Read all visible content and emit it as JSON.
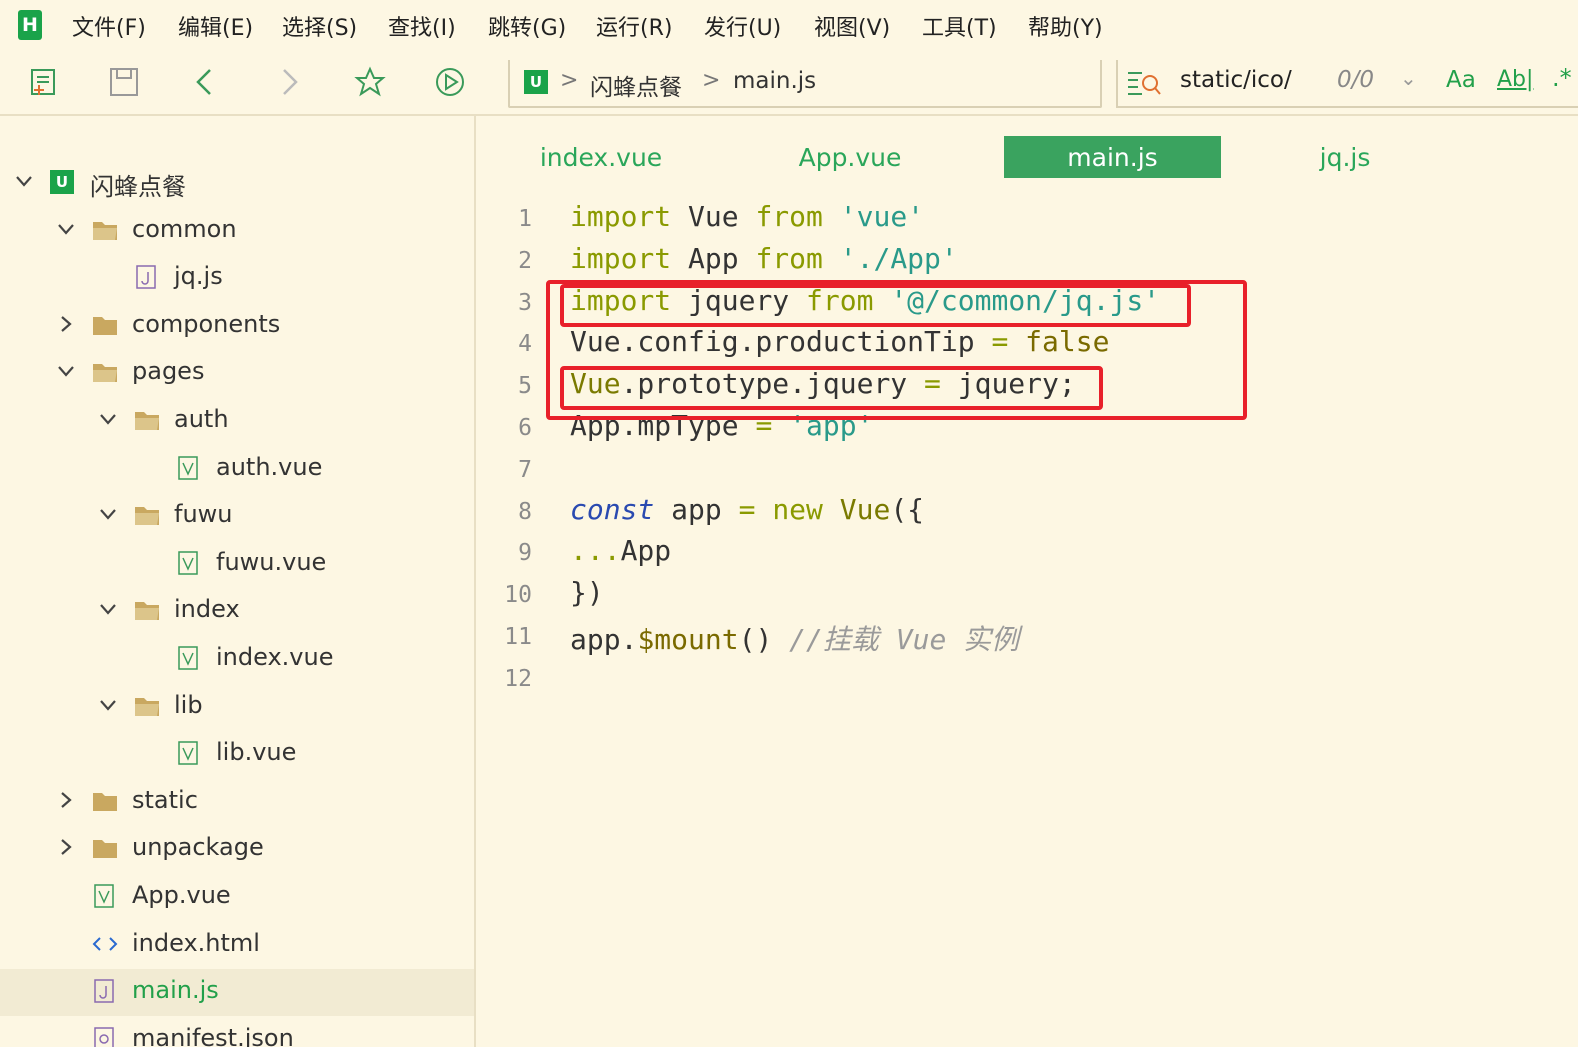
{
  "app": {
    "logo_letter": "H",
    "menu": [
      "文件(F)",
      "编辑(E)",
      "选择(S)",
      "查找(I)",
      "跳转(G)",
      "运行(R)",
      "发行(U)",
      "视图(V)",
      "工具(T)",
      "帮助(Y)"
    ]
  },
  "toolbar": {
    "icons": [
      "new-file-icon",
      "save-icon",
      "back-arrow-icon",
      "forward-arrow-icon",
      "star-icon",
      "run-icon"
    ]
  },
  "breadcrumb": {
    "project_icon_letter": "U",
    "separator": ">",
    "project": "闪蜂点餐",
    "file": "main.js"
  },
  "search": {
    "query": "static/ico/",
    "count": "0/0",
    "chevron": "⌄",
    "case_label": "Aa",
    "word_label": "Ab|",
    "regex_label": ".*"
  },
  "sidebar": {
    "root_icon_letter": "U",
    "items": [
      {
        "label": "闪蜂点餐",
        "type": "project",
        "chevron": "down"
      },
      {
        "label": "common",
        "type": "folder",
        "chevron": "down"
      },
      {
        "label": "jq.js",
        "type": "js-file"
      },
      {
        "label": "components",
        "type": "folder",
        "chevron": "right"
      },
      {
        "label": "pages",
        "type": "folder",
        "chevron": "down"
      },
      {
        "label": "auth",
        "type": "folder",
        "chevron": "down"
      },
      {
        "label": "auth.vue",
        "type": "vue-file"
      },
      {
        "label": "fuwu",
        "type": "folder",
        "chevron": "down"
      },
      {
        "label": "fuwu.vue",
        "type": "vue-file"
      },
      {
        "label": "index",
        "type": "folder",
        "chevron": "down"
      },
      {
        "label": "index.vue",
        "type": "vue-file"
      },
      {
        "label": "lib",
        "type": "folder",
        "chevron": "down"
      },
      {
        "label": "lib.vue",
        "type": "vue-file"
      },
      {
        "label": "static",
        "type": "folder",
        "chevron": "right"
      },
      {
        "label": "unpackage",
        "type": "folder",
        "chevron": "right"
      },
      {
        "label": "App.vue",
        "type": "vue-file"
      },
      {
        "label": "index.html",
        "type": "html-file"
      },
      {
        "label": "main.js",
        "type": "js-file",
        "selected": true
      },
      {
        "label": "manifest.json",
        "type": "json-file"
      }
    ]
  },
  "tabs": [
    {
      "label": "index.vue",
      "active": false
    },
    {
      "label": "App.vue",
      "active": false
    },
    {
      "label": "main.js",
      "active": true
    },
    {
      "label": "jq.js",
      "active": false
    }
  ],
  "code": {
    "line_numbers": [
      "1",
      "2",
      "3",
      "4",
      "5",
      "6",
      "7",
      "8",
      "9",
      "10",
      "11",
      "12"
    ],
    "lines": [
      {
        "tokens": [
          {
            "t": "import",
            "c": "kw"
          },
          {
            "t": " Vue ",
            "c": ""
          },
          {
            "t": "from",
            "c": "kw"
          },
          {
            "t": " ",
            "c": ""
          },
          {
            "t": "'vue'",
            "c": "str"
          }
        ]
      },
      {
        "tokens": [
          {
            "t": "import",
            "c": "kw"
          },
          {
            "t": " App ",
            "c": ""
          },
          {
            "t": "from",
            "c": "kw"
          },
          {
            "t": " ",
            "c": ""
          },
          {
            "t": "'./App'",
            "c": "str"
          }
        ]
      },
      {
        "tokens": [
          {
            "t": "import",
            "c": "kw"
          },
          {
            "t": " jquery ",
            "c": ""
          },
          {
            "t": "from",
            "c": "kw"
          },
          {
            "t": " ",
            "c": ""
          },
          {
            "t": "'@/common/jq.js'",
            "c": "str"
          }
        ]
      },
      {
        "tokens": [
          {
            "t": "Vue.config.productionTip ",
            "c": ""
          },
          {
            "t": "=",
            "c": "op"
          },
          {
            "t": " ",
            "c": ""
          },
          {
            "t": "false",
            "c": "fn"
          }
        ]
      },
      {
        "tokens": [
          {
            "t": "Vue",
            "c": "cls"
          },
          {
            "t": ".prototype.jquery ",
            "c": ""
          },
          {
            "t": "=",
            "c": "op"
          },
          {
            "t": " jquery;",
            "c": ""
          }
        ]
      },
      {
        "tokens": [
          {
            "t": "App.mpType ",
            "c": ""
          },
          {
            "t": "=",
            "c": "op"
          },
          {
            "t": " ",
            "c": ""
          },
          {
            "t": "'app'",
            "c": "str"
          }
        ]
      },
      {
        "tokens": []
      },
      {
        "tokens": [
          {
            "t": "const",
            "c": "kw2"
          },
          {
            "t": " app ",
            "c": ""
          },
          {
            "t": "=",
            "c": "op"
          },
          {
            "t": " ",
            "c": ""
          },
          {
            "t": "new",
            "c": "kw"
          },
          {
            "t": " ",
            "c": ""
          },
          {
            "t": "Vue",
            "c": "cls"
          },
          {
            "t": "({",
            "c": ""
          }
        ]
      },
      {
        "tokens": [
          {
            "t": "...",
            "c": "op"
          },
          {
            "t": "App",
            "c": ""
          }
        ]
      },
      {
        "tokens": [
          {
            "t": "})",
            "c": ""
          }
        ]
      },
      {
        "tokens": [
          {
            "t": "app.",
            "c": ""
          },
          {
            "t": "$mount",
            "c": "fn"
          },
          {
            "t": "() ",
            "c": ""
          },
          {
            "t": "//挂载 Vue 实例",
            "c": "cmt"
          }
        ]
      },
      {
        "tokens": []
      }
    ]
  },
  "colors": {
    "background": "#fdf7e3",
    "accent": "#1aa34a",
    "highlight": "#e8202a",
    "active_tab": "#3aa35f"
  }
}
